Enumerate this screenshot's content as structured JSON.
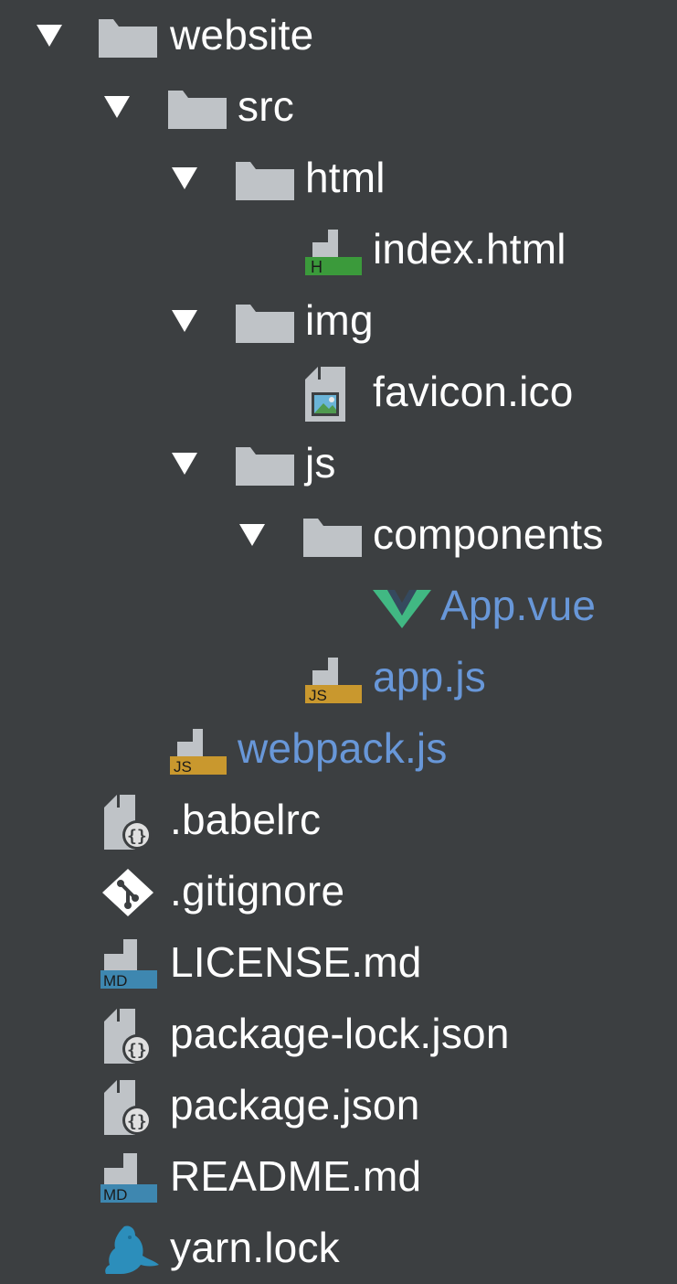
{
  "colors": {
    "background": "#3c3f41",
    "text": "#ffffff",
    "modified_text": "#6897d8",
    "folder": "#bfc3c7",
    "arrow": "#ffffff",
    "html_badge": "#3b9a3b",
    "js_badge": "#c9982e",
    "md_badge": "#3e87b0",
    "vue_green": "#41b883",
    "vue_dark": "#35495e",
    "yarn_blue": "#2c8ebb"
  },
  "tree": {
    "items": [
      {
        "label": "website",
        "icon": "folder-icon",
        "expanded": true,
        "modified": false
      },
      {
        "label": "src",
        "icon": "folder-icon",
        "expanded": true,
        "modified": false
      },
      {
        "label": "html",
        "icon": "folder-icon",
        "expanded": true,
        "modified": false
      },
      {
        "label": "index.html",
        "icon": "html-file-icon",
        "badge": "H",
        "modified": false
      },
      {
        "label": "img",
        "icon": "folder-icon",
        "expanded": true,
        "modified": false
      },
      {
        "label": "favicon.ico",
        "icon": "image-file-icon",
        "modified": false
      },
      {
        "label": "js",
        "icon": "folder-icon",
        "expanded": true,
        "modified": false
      },
      {
        "label": "components",
        "icon": "folder-icon",
        "expanded": true,
        "modified": false
      },
      {
        "label": "App.vue",
        "icon": "vue-icon",
        "modified": true
      },
      {
        "label": "app.js",
        "icon": "js-file-icon",
        "badge": "JS",
        "modified": true
      },
      {
        "label": "webpack.js",
        "icon": "js-file-icon",
        "badge": "JS",
        "modified": true
      },
      {
        "label": ".babelrc",
        "icon": "config-file-icon",
        "modified": false
      },
      {
        "label": ".gitignore",
        "icon": "git-icon",
        "modified": false
      },
      {
        "label": "LICENSE.md",
        "icon": "markdown-file-icon",
        "badge": "MD",
        "modified": false
      },
      {
        "label": "package-lock.json",
        "icon": "config-file-icon",
        "modified": false
      },
      {
        "label": "package.json",
        "icon": "config-file-icon",
        "modified": false
      },
      {
        "label": "README.md",
        "icon": "markdown-file-icon",
        "badge": "MD",
        "modified": false
      },
      {
        "label": "yarn.lock",
        "icon": "yarn-icon",
        "modified": false
      }
    ]
  }
}
